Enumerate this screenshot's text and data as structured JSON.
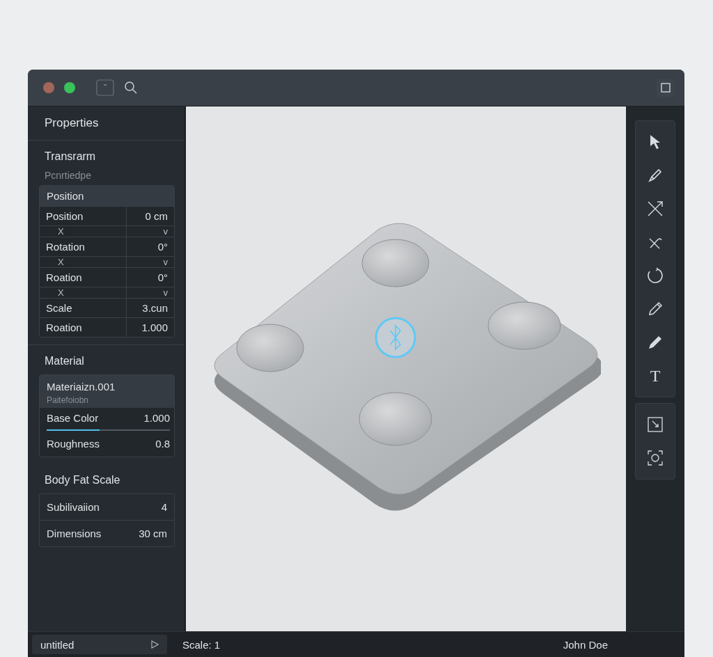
{
  "window": {
    "controls": [
      {
        "color": "#a0675a"
      },
      {
        "color": "#39c25a"
      }
    ]
  },
  "properties": {
    "title": "Properties",
    "transform": {
      "title": "Transrarm",
      "subtitle": "Pcnrtiedpe",
      "group": "Position",
      "rows": [
        {
          "kind": "value",
          "label": "Position",
          "value": "0 cm"
        },
        {
          "kind": "axis",
          "label": "X",
          "value": "v"
        },
        {
          "kind": "value",
          "label": "Rotation",
          "value": "0°"
        },
        {
          "kind": "axis",
          "label": "X",
          "value": "v"
        },
        {
          "kind": "value",
          "label": "Roation",
          "value": "0°"
        },
        {
          "kind": "axis",
          "label": "X",
          "value": "v"
        },
        {
          "kind": "value",
          "label": "Scale",
          "value": "3.cun"
        },
        {
          "kind": "value",
          "label": "Roation",
          "value": "1.000"
        }
      ]
    },
    "material": {
      "title": "Material",
      "name": "Materiaizn.001",
      "subtitle": "Paitefoiobn",
      "rows": [
        {
          "kind": "slider",
          "label": "Base Color",
          "value": "1.000",
          "level": 0.43
        },
        {
          "kind": "value",
          "label": "Roughness",
          "value": "0.8"
        }
      ]
    },
    "object": {
      "title": "Body Fat Scale",
      "rows": [
        {
          "label": "Subilivaiion",
          "value": "4"
        },
        {
          "label": "Dimensions",
          "value": "30 cm"
        }
      ]
    }
  },
  "tools": [
    {
      "kind": "pointer",
      "selected": false
    },
    {
      "kind": "pen",
      "selected": false
    },
    {
      "kind": "cross",
      "selected": false
    },
    {
      "kind": "bend",
      "selected": false
    },
    {
      "kind": "rotate",
      "selected": false
    },
    {
      "kind": "pencil-outline",
      "selected": false
    },
    {
      "kind": "pencil",
      "selected": false
    },
    {
      "kind": "text",
      "glyph": "T",
      "selected": false
    }
  ],
  "tools_extra": [
    {
      "kind": "crop"
    },
    {
      "kind": "focus"
    }
  ],
  "status_bar": {
    "file": "untitled",
    "scale": "Scale: 1",
    "user": "John Doe"
  }
}
